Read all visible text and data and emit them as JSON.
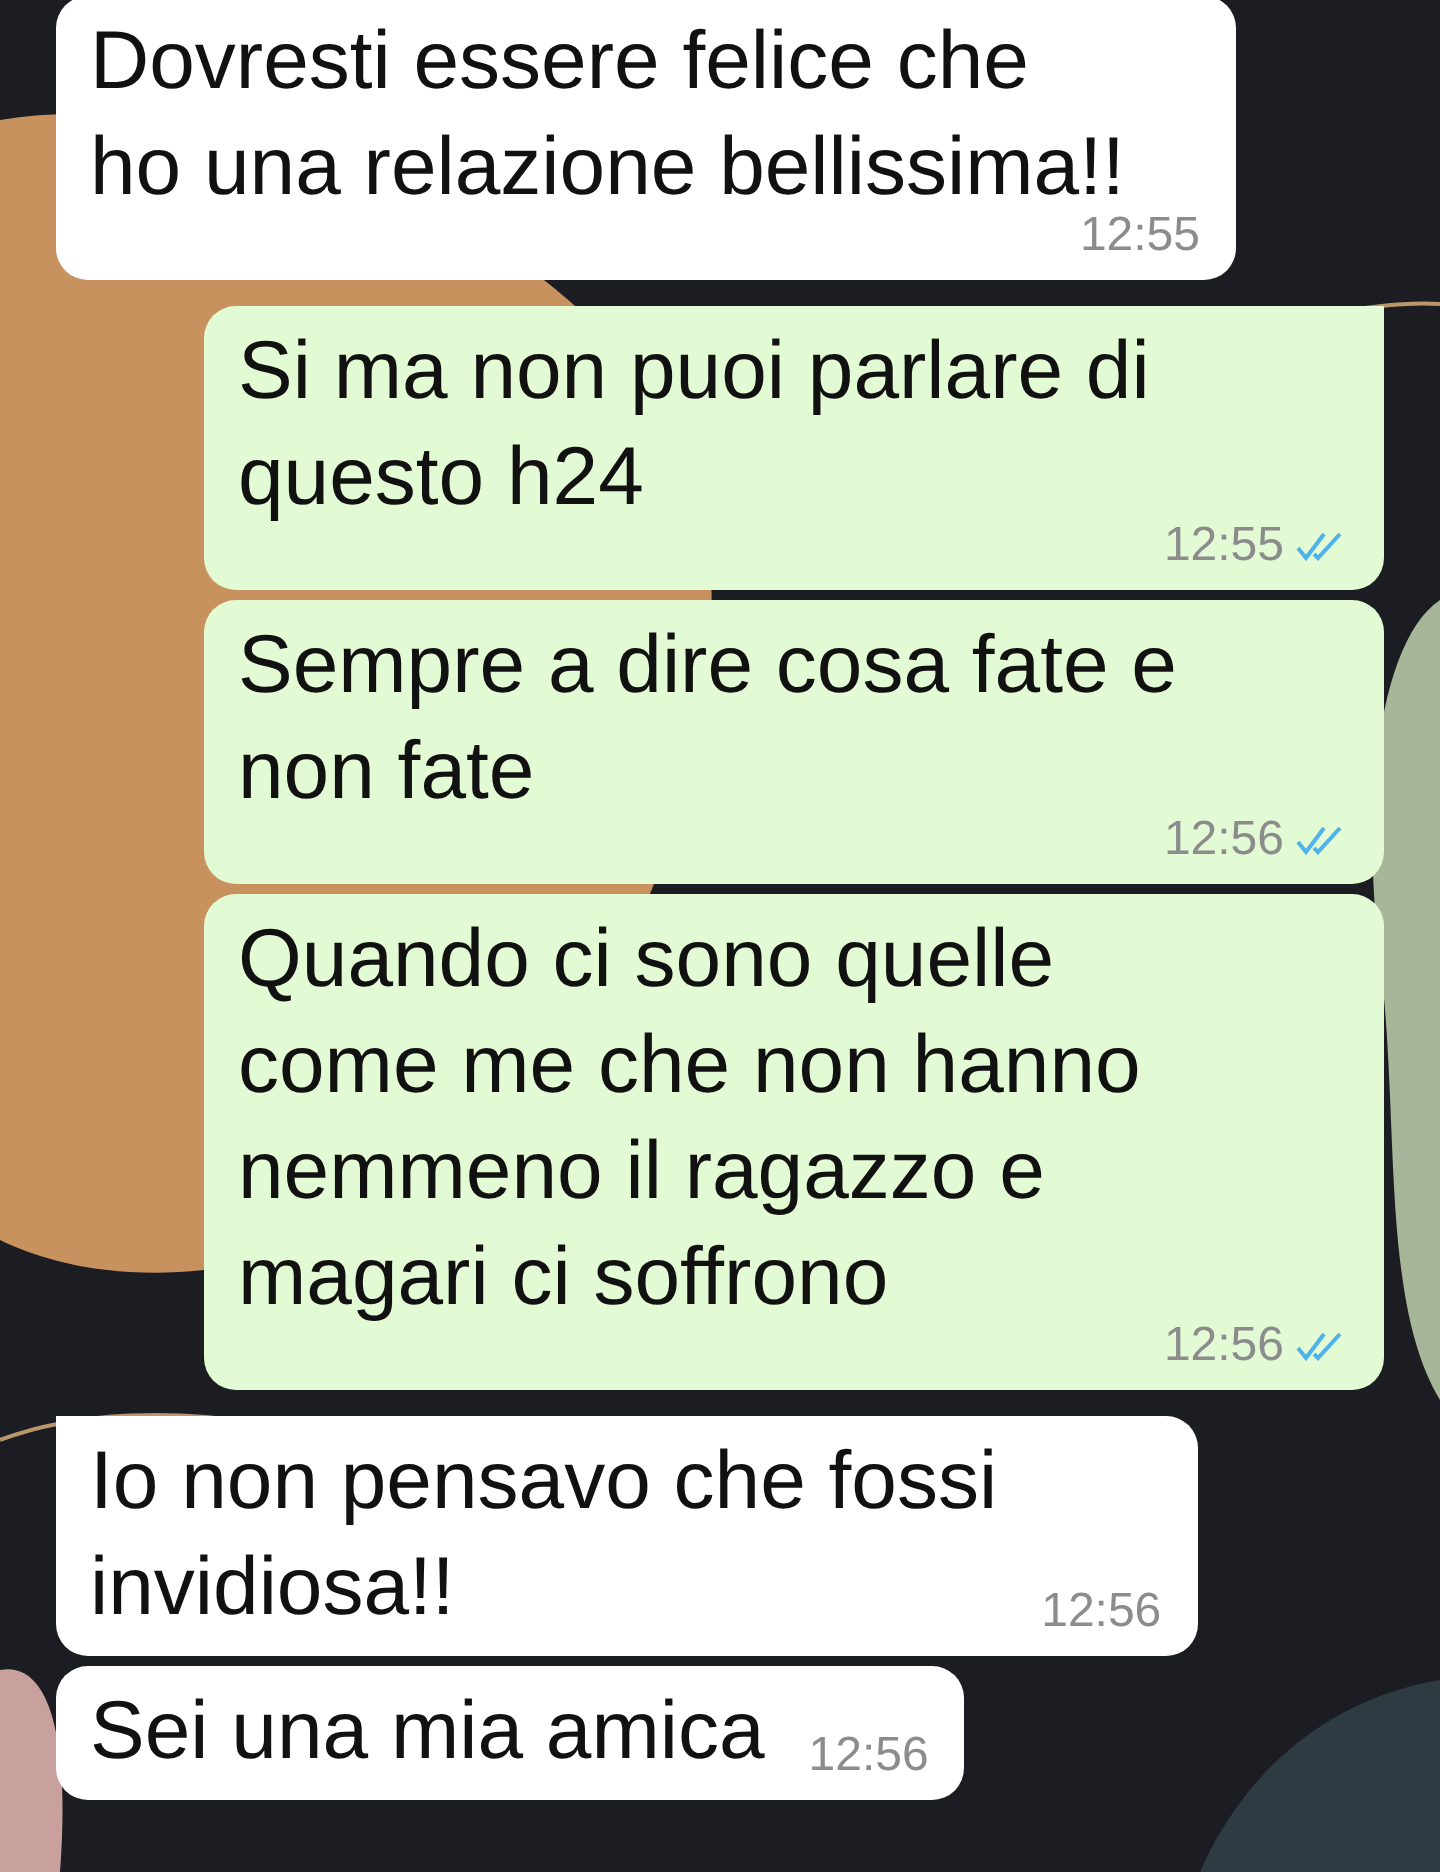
{
  "messages": [
    {
      "kind": "in",
      "text": "Dovresti essere felice che\nho una relazione bellissima!!",
      "time": "12:55",
      "tail": false
    },
    {
      "kind": "out",
      "text": "Si ma non puoi parlare di\nquesto h24",
      "time": "12:55",
      "read": true,
      "tail": true
    },
    {
      "kind": "out",
      "text": "Sempre a dire cosa fate e\nnon fate",
      "time": "12:56",
      "read": true,
      "tail": false
    },
    {
      "kind": "out",
      "text": "Quando ci sono quelle\ncome me che non hanno\nnemmeno il ragazzo e\nmagari ci soffrono",
      "time": "12:56",
      "read": true,
      "tail": false
    },
    {
      "kind": "in",
      "text": "Io non pensavo che fossi\ninvidiosa!!",
      "time": "12:56",
      "tail": true
    },
    {
      "kind": "in",
      "text": "Sei una mia amica",
      "time": "12:56",
      "tail": false
    }
  ]
}
